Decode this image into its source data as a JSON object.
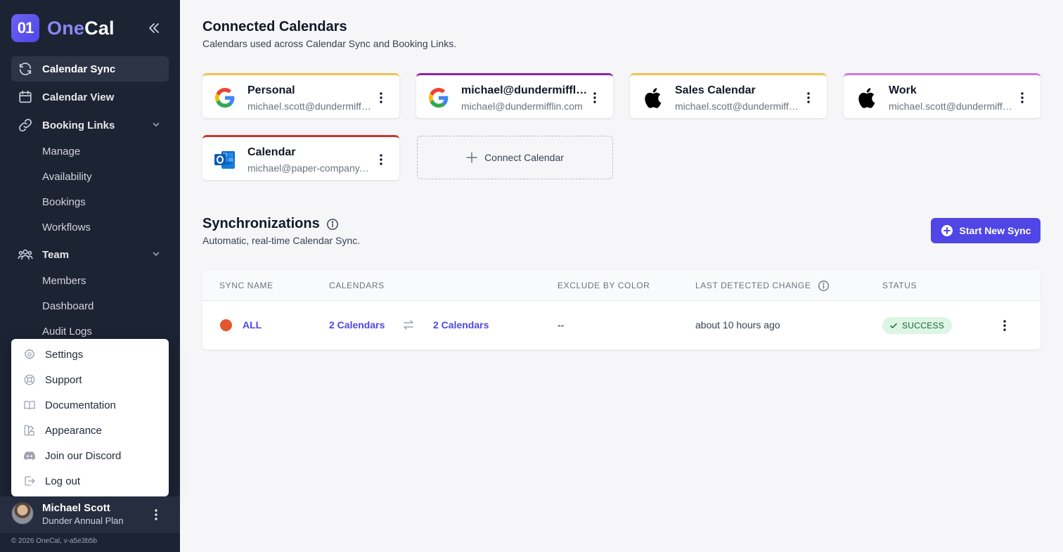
{
  "app": {
    "logo_mark": "01",
    "logo_one": "One",
    "logo_cal": "Cal"
  },
  "sidebar": {
    "nav": [
      {
        "label": "Calendar Sync",
        "icon": "sync-icon",
        "active": true
      },
      {
        "label": "Calendar View",
        "icon": "calendar-icon"
      },
      {
        "label": "Booking Links",
        "icon": "link-icon",
        "expandable": true
      },
      {
        "label": "Team",
        "icon": "team-icon",
        "expandable": true
      }
    ],
    "booking_sub": [
      "Manage",
      "Availability",
      "Bookings",
      "Workflows"
    ],
    "team_sub": [
      "Members",
      "Dashboard",
      "Audit Logs"
    ],
    "menu": [
      {
        "label": "Settings",
        "icon": "gear-icon"
      },
      {
        "label": "Support",
        "icon": "lifebuoy-icon"
      },
      {
        "label": "Documentation",
        "icon": "book-icon"
      },
      {
        "label": "Appearance",
        "icon": "palette-icon"
      },
      {
        "label": "Join our Discord",
        "icon": "discord-icon"
      },
      {
        "label": "Log out",
        "icon": "logout-icon"
      }
    ],
    "user": {
      "name": "Michael Scott",
      "plan": "Dunder Annual Plan"
    },
    "copyright": "© 2026 OneCal, v-a5e3b5b"
  },
  "connected": {
    "title": "Connected Calendars",
    "subtitle": "Calendars used across Calendar Sync and Booking Links.",
    "calendars": [
      {
        "name": "Personal",
        "email": "michael.scott@dundermifflin.com",
        "provider": "google",
        "color": "#f0c453"
      },
      {
        "name": "michael@dundermifflin.com",
        "email": "michael@dundermifflin.com",
        "provider": "google",
        "color": "#8e24aa"
      },
      {
        "name": "Sales Calendar",
        "email": "michael.scott@dundermifflin.com",
        "provider": "apple",
        "color": "#f0c453"
      },
      {
        "name": "Work",
        "email": "michael.scott@dundermifflin.com",
        "provider": "apple",
        "color": "#c77dd7"
      },
      {
        "name": "Calendar",
        "email": "michael@paper-company.com",
        "provider": "outlook",
        "color": "#c0392b"
      }
    ],
    "connect_label": "Connect Calendar"
  },
  "sync": {
    "title": "Synchronizations",
    "subtitle": "Automatic, real-time Calendar Sync.",
    "start_label": "Start New Sync",
    "columns": [
      "SYNC NAME",
      "CALENDARS",
      "EXCLUDE BY COLOR",
      "LAST DETECTED CHANGE",
      "STATUS"
    ],
    "rows": [
      {
        "name": "ALL",
        "dot_color": "#e1572f",
        "from": "2 Calendars",
        "to": "2 Calendars",
        "exclude": "--",
        "last_change": "about 10 hours ago",
        "status": "SUCCESS"
      }
    ]
  }
}
